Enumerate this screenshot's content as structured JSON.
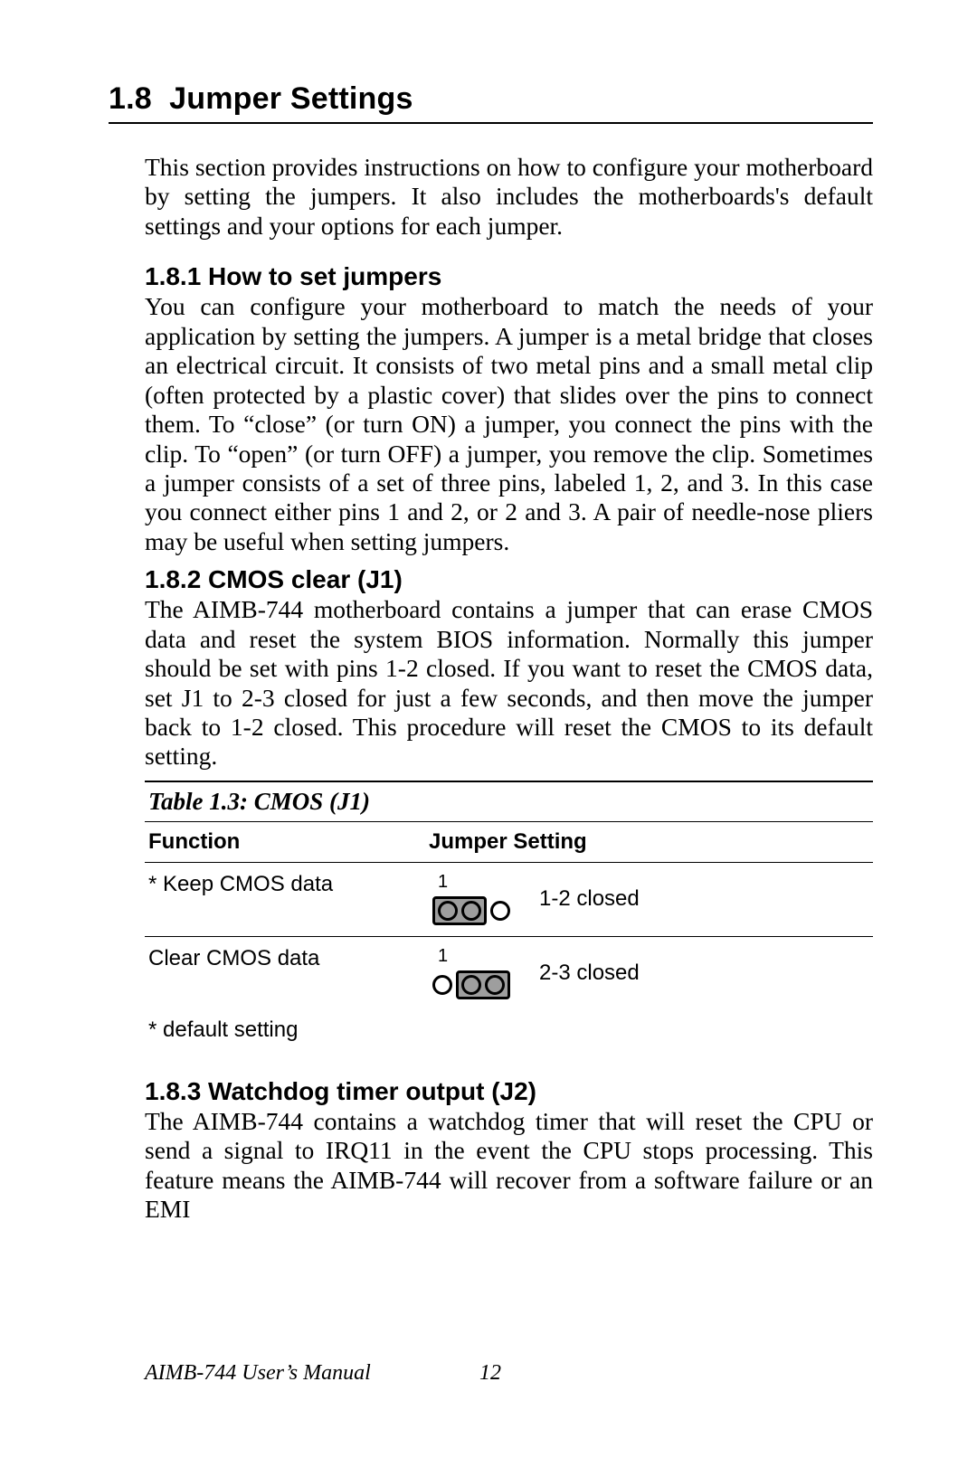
{
  "section": {
    "number": "1.8",
    "title": "Jumper Settings",
    "intro": "This section provides instructions on how to configure your motherboard by setting the jumpers. It also includes the motherboards's default settings and your options for each jumper."
  },
  "sub1": {
    "heading": "1.8.1 How to set jumpers",
    "body": "You can configure your motherboard to match the needs of your application by setting the jumpers. A jumper is a metal bridge that closes an electrical circuit. It consists of two metal pins and a small metal clip (often protected by a plastic cover) that slides over the pins to connect them. To “close” (or turn ON) a jumper, you connect the pins with the clip. To “open” (or turn OFF) a jumper, you remove the clip. Sometimes a jumper consists of a set of three pins, labeled 1, 2, and 3. In this case you connect either pins 1 and 2, or 2 and 3. A pair of needle-nose pliers may be useful when setting jumpers."
  },
  "sub2": {
    "heading": "1.8.2 CMOS clear (J1)",
    "body": "The AIMB-744 motherboard contains a jumper that can erase CMOS data and reset the system BIOS information. Normally this jumper should be set with pins 1-2 closed. If you want to reset the CMOS data, set J1 to 2-3 closed for just a few seconds, and then move the jumper back to 1-2 closed. This procedure will reset the CMOS to its default setting."
  },
  "table": {
    "caption": "Table 1.3: CMOS (J1)",
    "col1": "Function",
    "col2": "Jumper Setting",
    "rows": [
      {
        "func": "* Keep CMOS data",
        "pin_label": "1",
        "setting_text": "1-2 closed"
      },
      {
        "func": "Clear CMOS data",
        "pin_label": "1",
        "setting_text": "2-3 closed"
      }
    ],
    "footnote": "* default setting"
  },
  "sub3": {
    "heading": "1.8.3 Watchdog timer output (J2)",
    "body": "The AIMB-744 contains a watchdog timer that will reset the CPU or send a signal to IRQ11 in the event the CPU stops processing. This feature means the AIMB-744 will recover from a software failure or an EMI"
  },
  "footer": {
    "manual": "AIMB-744 User’s Manual",
    "page": "12"
  }
}
